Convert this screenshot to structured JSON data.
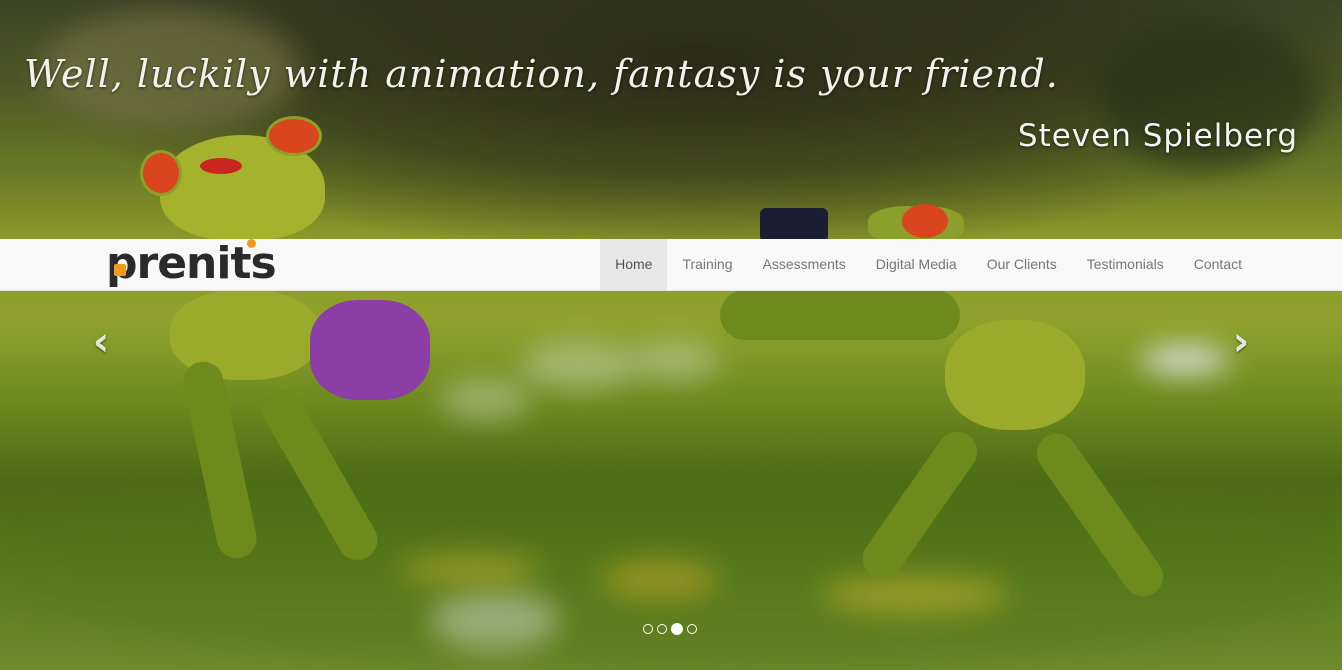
{
  "hero": {
    "quote": "Well, luckily with animation, fantasy is your friend.",
    "author": "Steven Spielberg"
  },
  "navbar": {
    "logo_text": "prenits",
    "items": [
      {
        "label": "Home",
        "active": true
      },
      {
        "label": "Training",
        "active": false
      },
      {
        "label": "Assessments",
        "active": false
      },
      {
        "label": "Digital Media",
        "active": false
      },
      {
        "label": "Our Clients",
        "active": false
      },
      {
        "label": "Testimonials",
        "active": false
      },
      {
        "label": "Contact",
        "active": false
      }
    ]
  },
  "carousel": {
    "prev_icon": "chevron-left-icon",
    "next_icon": "chevron-right-icon",
    "slide_count": 4,
    "active_slide": 3
  },
  "colors": {
    "logo_accent": "#f29b1a",
    "nav_bg": "#f8f8f8",
    "nav_active_bg": "#e7e7e7",
    "nav_text": "#777777"
  }
}
